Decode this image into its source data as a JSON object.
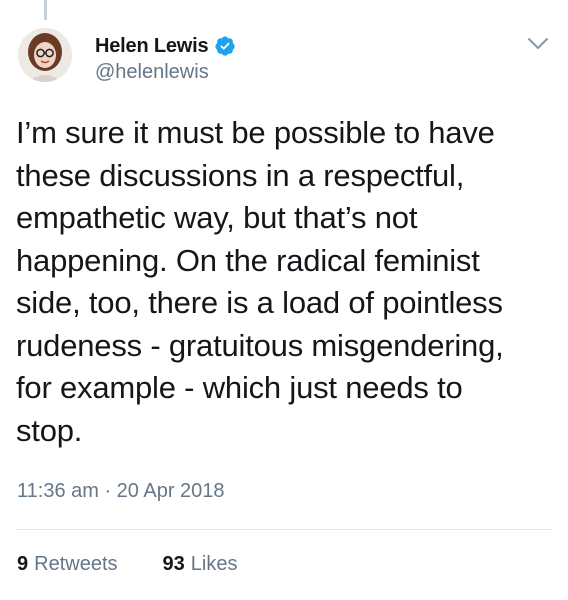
{
  "tweet": {
    "author": {
      "display_name": "Helen Lewis",
      "handle": "@helenlewis",
      "verified": true
    },
    "text_lines": [
      "I’m sure it must be possible to have",
      "these discussions in a respectful,",
      "empathetic way, but that’s not",
      "happening. On the radical feminist",
      "side, too, there is a load of pointless",
      "rudeness - gratuitous misgendering,",
      "for example - which just needs to",
      "stop."
    ],
    "timestamp": "11:36 am · 20 Apr 2018",
    "stats": {
      "retweets_count": "9",
      "retweets_label": "Retweets",
      "likes_count": "93",
      "likes_label": "Likes"
    }
  },
  "icons": {
    "verified": "verified-badge-icon",
    "menu": "chevron-down-icon"
  },
  "colors": {
    "text_primary": "#14171a",
    "text_secondary": "#657786",
    "verified_blue": "#1da1f2",
    "divider": "#e1e8ed",
    "thread_line": "#c4cfd6"
  }
}
